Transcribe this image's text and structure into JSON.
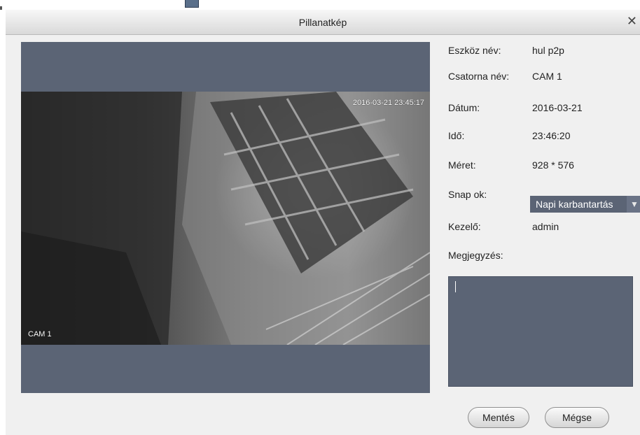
{
  "dialog": {
    "title": "Pillanatkép",
    "close_symbol": "✕"
  },
  "video": {
    "timestamp": "2016-03-21 23:45:17",
    "camera_label": "CAM 1"
  },
  "info": {
    "device_name_label": "Eszköz név:",
    "device_name_value": "hul p2p",
    "channel_name_label": "Csatorna név:",
    "channel_name_value": "CAM 1",
    "date_label": "Dátum:",
    "date_value": "2016-03-21",
    "time_label": "Idő:",
    "time_value": "23:46:20",
    "size_label": "Méret:",
    "size_value": "928 * 576",
    "snap_reason_label": "Snap ok:",
    "snap_reason_value": "Napi karbantartás",
    "operator_label": "Kezelő:",
    "operator_value": "admin",
    "note_label": "Megjegyzés:"
  },
  "buttons": {
    "save_label": "Mentés",
    "cancel_label": "Mégse"
  },
  "icons": {
    "close": "close-icon",
    "dropdown": "chevron-down-icon"
  },
  "colors": {
    "panel": "#5b6475",
    "background": "#f0f0f0"
  }
}
